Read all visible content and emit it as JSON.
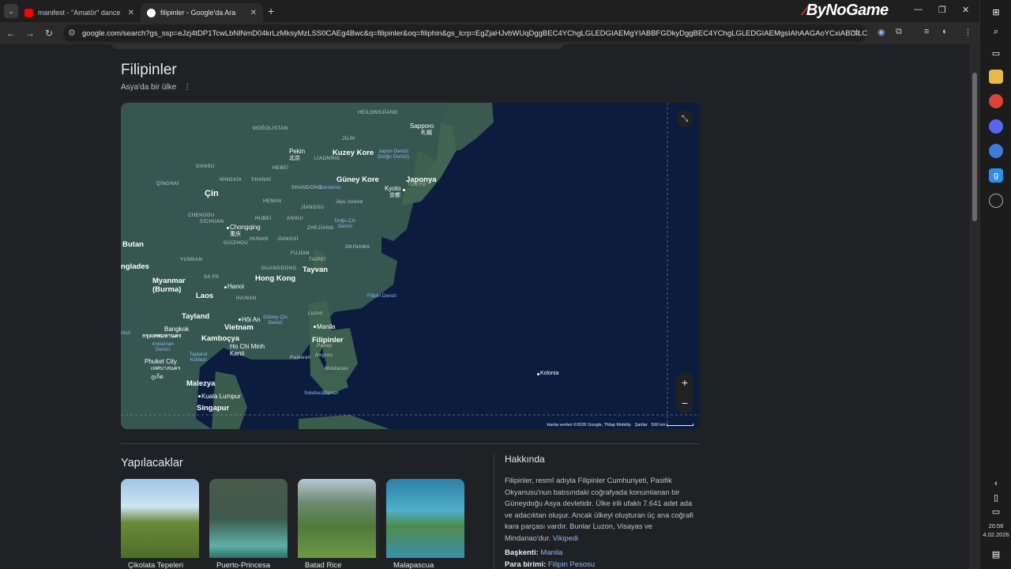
{
  "tabs": [
    {
      "title": "manifest - \"Amatör\" dance"
    },
    {
      "title": "filipinler - Google'da Ara"
    }
  ],
  "brand": {
    "name": "ByNoGame"
  },
  "address": {
    "url": "google.com/search?gs_ssp=eJzj4tDP1TcwLbNlNmD04krLzMksyMzLSS0CAEg4Bwc&q=filipinler&oq=filiphin&gs_lcrp=EgZjaHJvbWUqDggBEC4YChgLGLEDGIAEMgYIABBFGDkyDggBEC4YChgLGLEDGIAEMgsIAhAAGAoYCxiABDILCAMQ..."
  },
  "entity": {
    "title": "Filipinler",
    "subtitle": "Asya'da bir ülke"
  },
  "map": {
    "labels": {
      "mogolistan": "MOĞOLİSTAN",
      "sapporo": "Sapporo",
      "sapporo_ja": "札幌",
      "pekin": "Pekin",
      "pekin_zh": "北京",
      "kuzey_kore": "Kuzey Kore",
      "japon_denizi": "Japon Denizi (Doğu Denizi)",
      "guney_kore": "Güney Kore",
      "japonya": "Japonya",
      "kyoto": "Kyoto",
      "kyoto_ja": "京都",
      "tokyo": "TOKYO",
      "sandeniz": "Sarıdeniz",
      "jeju": "Jeju Island",
      "cin": "Çin",
      "chongqing": "Chongqing",
      "chongqing_zh": "重庆",
      "dogu_cin": "Doğu Çin Denizi",
      "okinawa": "OKINAWA",
      "butan": "Butan",
      "banglades": "nglades",
      "tayvan": "Tayvan",
      "taipei": "TAİPEİ",
      "hong_kong": "Hong Kong",
      "myanmar": "Myanmar (Burma)",
      "hanoi": "Hanoi",
      "laos": "Laos",
      "filipin_denizi": "Filipin Denizi",
      "tayland": "Tayland",
      "ho_an": "Hội An",
      "vietnam": "Vietnam",
      "guney_cin": "Güney Çin Denizi",
      "luzon": "Luzon",
      "manila": "Manila",
      "bangkok": "Bangkok",
      "bangkok_th": "กรุงเทพมหานคร",
      "kambocya": "Kamboçya",
      "filipinler": "Filipinler",
      "ho_chi_minh": "Ho Chi Minh Kenti",
      "andaman": "Andaman Denizi",
      "tayland_korfezi": "Tayland Körfezi",
      "panay": "Panay",
      "palawan": "Palawan",
      "negros": "Negros",
      "mindanao": "Mindanao",
      "phuket": "Phuket City",
      "phuket_th": "เทศบาลนครภูเก็ต",
      "kolonia": "Kolonia",
      "malezya": "Malezya",
      "kuala_lumpur": "Kuala Lumpur",
      "selebes": "Selebes Denizi",
      "singapur": "Singapur",
      "korfezi": "rfezi",
      "henan": "HENAN",
      "anhui": "ANHUI",
      "gansu": "GANSU",
      "sichuan": "SİCHUAN",
      "hubei": "HUBEI",
      "guizhou": "GUİZHOU",
      "guangdong": "GUANGDONG",
      "yunnan": "YUNNAN",
      "sapa": "SA PA",
      "hainan": "HAINAN",
      "qinghai": "QİNGHAİ",
      "hunan": "HUNAN",
      "jiangxi": "JİANGXİ",
      "fujian": "FUJİAN",
      "zhejiang": "ZHEJİANG",
      "jiangsu": "JİANGSU",
      "shandong": "SHANDONG",
      "shanxi": "SHANXİ",
      "hebei": "HEBEİ",
      "liaoning": "LİAONİNG",
      "jilin": "JİLİN",
      "heilongjiang": "HEİLONGJİANG",
      "ningxia": "NİNGXİA",
      "chengdu": "CHENGDU"
    },
    "attribution": "Harita verileri ©2026 Google, TMap Mobility",
    "terms": "Şartlar",
    "scale": "500 km",
    "zoom_in": "+",
    "zoom_out": "−"
  },
  "things_to_do": {
    "title": "Yapılacaklar",
    "items": [
      {
        "label": "Çikolata Tepeleri",
        "color": "#6a8a3a"
      },
      {
        "label": "Puerto-Princesa",
        "color": "#3d5a4c"
      },
      {
        "label": "Batad Rice",
        "color": "#4f7a3c"
      },
      {
        "label": "Malapascua",
        "color": "#3a8fb0"
      }
    ]
  },
  "about": {
    "title": "Hakkında",
    "text": "Filipinler, resmî adıyla Filipinler Cumhuriyeti, Pasifik Okyanusu'nun batısındaki coğrafyada konumlanan bir Güneydoğu Asya devletidir. Ülke irili ufaklı 7.641 adet ada ve adacıktan oluşur. Ancak ülkeyi oluşturan üç ana coğrafi kara parçası vardır. Bunlar Luzon, Visayas ve Mindanao'dur.",
    "source": "Vikipedi",
    "capital_label": "Başkenti:",
    "capital_value": "Manila",
    "currency_label": "Para birimi:",
    "currency_value": "Filipin Pesosu"
  },
  "clock": {
    "time": "20:56",
    "date": "4.02.2026"
  },
  "colors": {
    "accent": "#8ab4f8",
    "map_ocean": "#0b1c3f",
    "map_land": "#35574f"
  }
}
